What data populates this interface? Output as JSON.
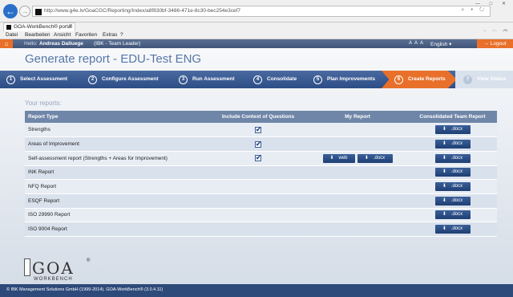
{
  "browser": {
    "url": "http://www.g4e.lv/GoaCGC/Reporting/Index/a8f830bf-3486-471e-8c30-bec254e3cef7",
    "address_icons": "⌕ ▾ ↻",
    "window_controls": "— □ ✕",
    "toolbar_icons": "⌂ ☆ ⚙",
    "tab_title": "GOA-WorkBench® portal",
    "menu": [
      "Datei",
      "Bearbeiten",
      "Ansicht",
      "Favoriten",
      "Extras",
      "?"
    ]
  },
  "header": {
    "hello": "Hello:",
    "user_name": "Andreas Dalluege",
    "user_role": "(IBK - Team Leader)",
    "font_size_control": "A A A",
    "language": "English ▾",
    "logout": "→ Logout"
  },
  "page_title": "Generate report - EDU-Test ENG",
  "steps": [
    {
      "num": "1",
      "label": "Select Assessment"
    },
    {
      "num": "2",
      "label": "Configure Assessment"
    },
    {
      "num": "3",
      "label": "Run Assessment"
    },
    {
      "num": "4",
      "label": "Consolidate"
    },
    {
      "num": "5",
      "label": "Plan Improvements"
    },
    {
      "num": "6",
      "label": "Create Reports"
    },
    {
      "num": "?",
      "label": "View Status"
    }
  ],
  "reports_heading": "Your reports:",
  "table": {
    "headers": [
      "Report Type",
      "Include Context of Questions",
      "My Report",
      "Consolidated Team Report"
    ],
    "rows": [
      {
        "type": "Strengths",
        "context": true
      },
      {
        "type": "Areas of Improvement",
        "context": true
      },
      {
        "type": "Self-assessment report (Strengths + Areas for Improvement)",
        "context": true
      },
      {
        "type": "INK Report"
      },
      {
        "type": "NFQ Report"
      },
      {
        "type": "ESQF Report"
      },
      {
        "type": "ISO 29990 Report"
      },
      {
        "type": "ISO 9004 Report"
      }
    ],
    "web_label": "web",
    "docx_label": ".docx",
    "check_glyph": "✔",
    "download_glyph": "⬇"
  },
  "logo": {
    "text": "GOA",
    "reg": "®",
    "sub": "WORKBENCH"
  },
  "footer": "© IBK Management Solutions GmbH (1999-2014). GOA-WorkBench® (3.0.4.11)"
}
